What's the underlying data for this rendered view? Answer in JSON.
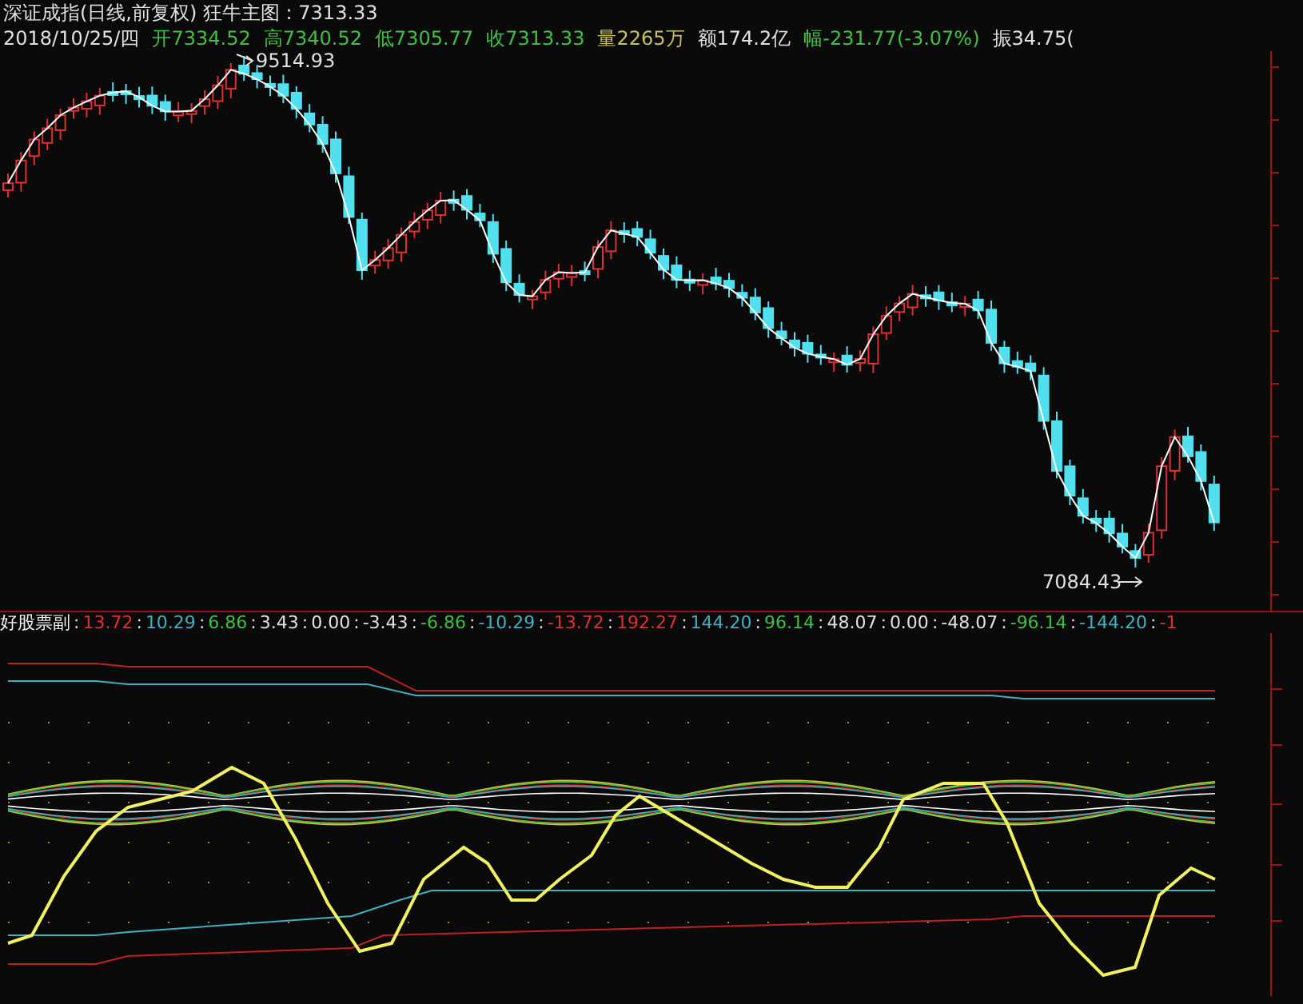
{
  "header": {
    "title": "深证成指(日线,前复权) 狂牛主图 : 7313.33",
    "quote": [
      {
        "text": "2018/10/25/四",
        "color": "#e0e0e0"
      },
      {
        "text": "开7334.52",
        "color": "#40c040"
      },
      {
        "text": "高7340.52",
        "color": "#40c040"
      },
      {
        "text": "低7305.77",
        "color": "#40c040"
      },
      {
        "text": "收7313.33",
        "color": "#40c040"
      },
      {
        "text": "量2265万",
        "color": "#c8c060"
      },
      {
        "text": "额174.2亿",
        "color": "#e0e0e0"
      },
      {
        "text": "幅-231.77(-3.07%)",
        "color": "#40c040"
      },
      {
        "text": "振34.75(",
        "color": "#e0e0e0"
      }
    ]
  },
  "main_chart": {
    "high_label": "9514.93",
    "low_label": "7084.43"
  },
  "indicator": {
    "name": "好股票副",
    "values": [
      {
        "sep": ":",
        "text": "13.72",
        "color": "#e03030"
      },
      {
        "sep": ":",
        "text": "10.29",
        "color": "#40b0c0"
      },
      {
        "sep": ":",
        "text": "6.86",
        "color": "#40c040"
      },
      {
        "sep": ":",
        "text": "3.43",
        "color": "#e0e0e0"
      },
      {
        "sep": ":",
        "text": "0.00",
        "color": "#e0e0e0"
      },
      {
        "sep": ":",
        "text": "-3.43",
        "color": "#e0e0e0"
      },
      {
        "sep": ":",
        "text": "-6.86",
        "color": "#40c040"
      },
      {
        "sep": ":",
        "text": "-10.29",
        "color": "#40b0c0"
      },
      {
        "sep": ":",
        "text": "-13.72",
        "color": "#e03030"
      },
      {
        "sep": ":",
        "text": "192.27",
        "color": "#e03030"
      },
      {
        "sep": ":",
        "text": "144.20",
        "color": "#40b0c0"
      },
      {
        "sep": ":",
        "text": "96.14",
        "color": "#40c040"
      },
      {
        "sep": ":",
        "text": "48.07",
        "color": "#e0e0e0"
      },
      {
        "sep": ":",
        "text": "0.00",
        "color": "#e0e0e0"
      },
      {
        "sep": ":",
        "text": "-48.07",
        "color": "#e0e0e0"
      },
      {
        "sep": ":",
        "text": "-96.14",
        "color": "#40c040"
      },
      {
        "sep": ":",
        "text": "-144.20",
        "color": "#40b0c0"
      },
      {
        "sep": ":",
        "text": "-1",
        "color": "#e03030"
      }
    ]
  }
}
